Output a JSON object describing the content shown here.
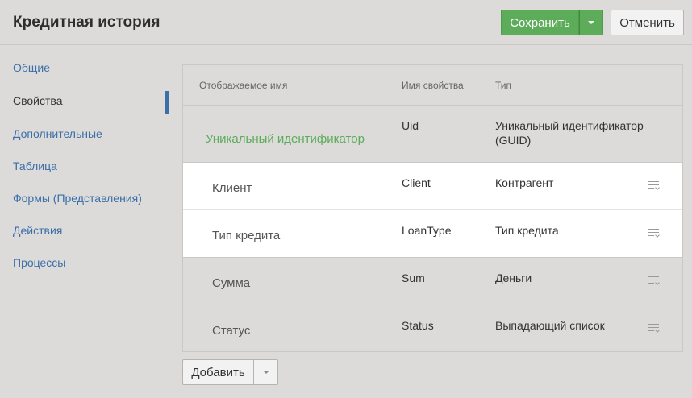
{
  "header": {
    "title": "Кредитная история",
    "save_label": "Сохранить",
    "cancel_label": "Отменить"
  },
  "sidebar": {
    "items": [
      {
        "label": "Общие"
      },
      {
        "label": "Свойства",
        "active": true
      },
      {
        "label": "Дополнительные"
      },
      {
        "label": "Таблица"
      },
      {
        "label": "Формы (Представления)"
      },
      {
        "label": "Действия"
      },
      {
        "label": "Процессы"
      }
    ]
  },
  "table": {
    "columns": [
      "Отображаемое имя",
      "Имя свойства",
      "Тип"
    ],
    "rows": [
      {
        "name": "Уникальный идентификатор",
        "property": "Uid",
        "type": "Уникальный идентификатор (GUID)"
      },
      {
        "name": "Клиент",
        "property": "Client",
        "type": "Контрагент"
      },
      {
        "name": "Тип кредита",
        "property": "LoanType",
        "type": "Тип кредита"
      },
      {
        "name": "Сумма",
        "property": "Sum",
        "type": "Деньги"
      },
      {
        "name": "Статус",
        "property": "Status",
        "type": "Выпадающий список"
      }
    ]
  },
  "footer": {
    "add_label": "Добавить"
  },
  "colors": {
    "accent_green": "#5cac5a",
    "link_blue": "#3a6fa8",
    "background": "#dcdbda"
  }
}
